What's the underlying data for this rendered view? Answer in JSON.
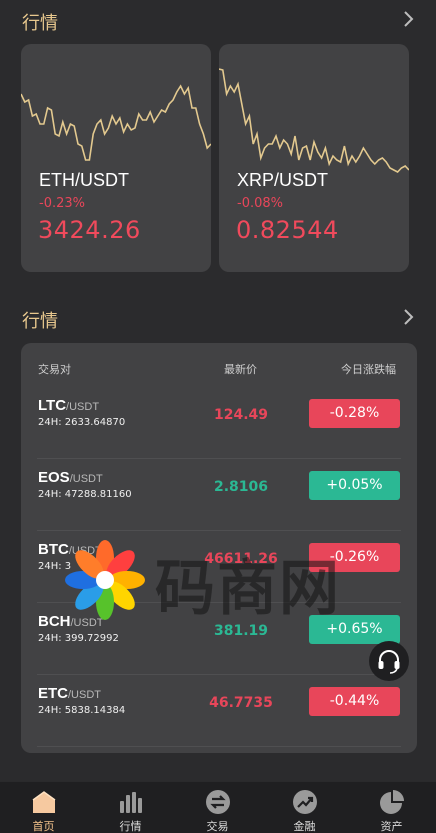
{
  "market_section_1": {
    "title": "行情"
  },
  "cards": [
    {
      "pair": "ETH/USDT",
      "change": "-0.23%",
      "price": "3424.26",
      "spark": [
        30,
        38,
        36,
        52,
        50,
        60,
        60,
        44,
        46,
        70,
        72,
        58,
        70,
        60,
        62,
        80,
        82,
        96,
        96,
        70,
        60,
        56,
        70,
        64,
        52,
        60,
        54,
        68,
        60,
        66,
        64,
        50,
        56,
        56,
        48,
        58,
        52,
        46,
        48,
        40,
        36,
        28,
        22,
        30,
        24,
        44,
        44,
        60,
        70,
        84,
        80
      ]
    },
    {
      "pair": "XRP/USDT",
      "change": "-0.08%",
      "price": "0.82544",
      "spark": [
        5,
        6,
        30,
        22,
        28,
        20,
        40,
        60,
        52,
        80,
        70,
        94,
        84,
        80,
        80,
        72,
        84,
        76,
        80,
        90,
        72,
        96,
        84,
        82,
        96,
        78,
        88,
        94,
        84,
        100,
        92,
        96,
        98,
        82,
        100,
        92,
        98,
        92,
        84,
        90,
        96,
        100,
        96,
        94,
        98,
        104,
        106,
        108,
        104,
        102,
        106
      ]
    }
  ],
  "market_section_2": {
    "title": "行情"
  },
  "table": {
    "headers": {
      "pair": "交易对",
      "last": "最新价",
      "change": "今日涨跌幅"
    },
    "rows": [
      {
        "base": "LTC",
        "quote": "/USDT",
        "volume": "24H: 2633.64870",
        "last": "124.49",
        "change": "-0.28%",
        "dir": "down"
      },
      {
        "base": "EOS",
        "quote": "/USDT",
        "volume": "24H: 47288.81160",
        "last": "2.8106",
        "change": "+0.05%",
        "dir": "up"
      },
      {
        "base": "BTC",
        "quote": "/USDT",
        "volume": "24H: 3",
        "last": "46611.26",
        "change": "-0.26%",
        "dir": "down"
      },
      {
        "base": "BCH",
        "quote": "/USDT",
        "volume": "24H: 399.72992",
        "last": "381.19",
        "change": "+0.65%",
        "dir": "up"
      },
      {
        "base": "ETC",
        "quote": "/USDT",
        "volume": "24H: 5838.14384",
        "last": "46.7735",
        "change": "-0.44%",
        "dir": "down"
      }
    ]
  },
  "watermark": {
    "text": "码商网"
  },
  "colors": {
    "accent": "#e8c88e",
    "down": "#e8465a",
    "up": "#2bb894",
    "tab_active": "#f5c48c"
  },
  "tabs": [
    {
      "label": "首页",
      "icon": "home-icon",
      "active": true
    },
    {
      "label": "行情",
      "icon": "bar-chart-icon",
      "active": false
    },
    {
      "label": "交易",
      "icon": "exchange-icon",
      "active": false
    },
    {
      "label": "金融",
      "icon": "trend-up-icon",
      "active": false
    },
    {
      "label": "资产",
      "icon": "pie-chart-icon",
      "active": false
    }
  ]
}
